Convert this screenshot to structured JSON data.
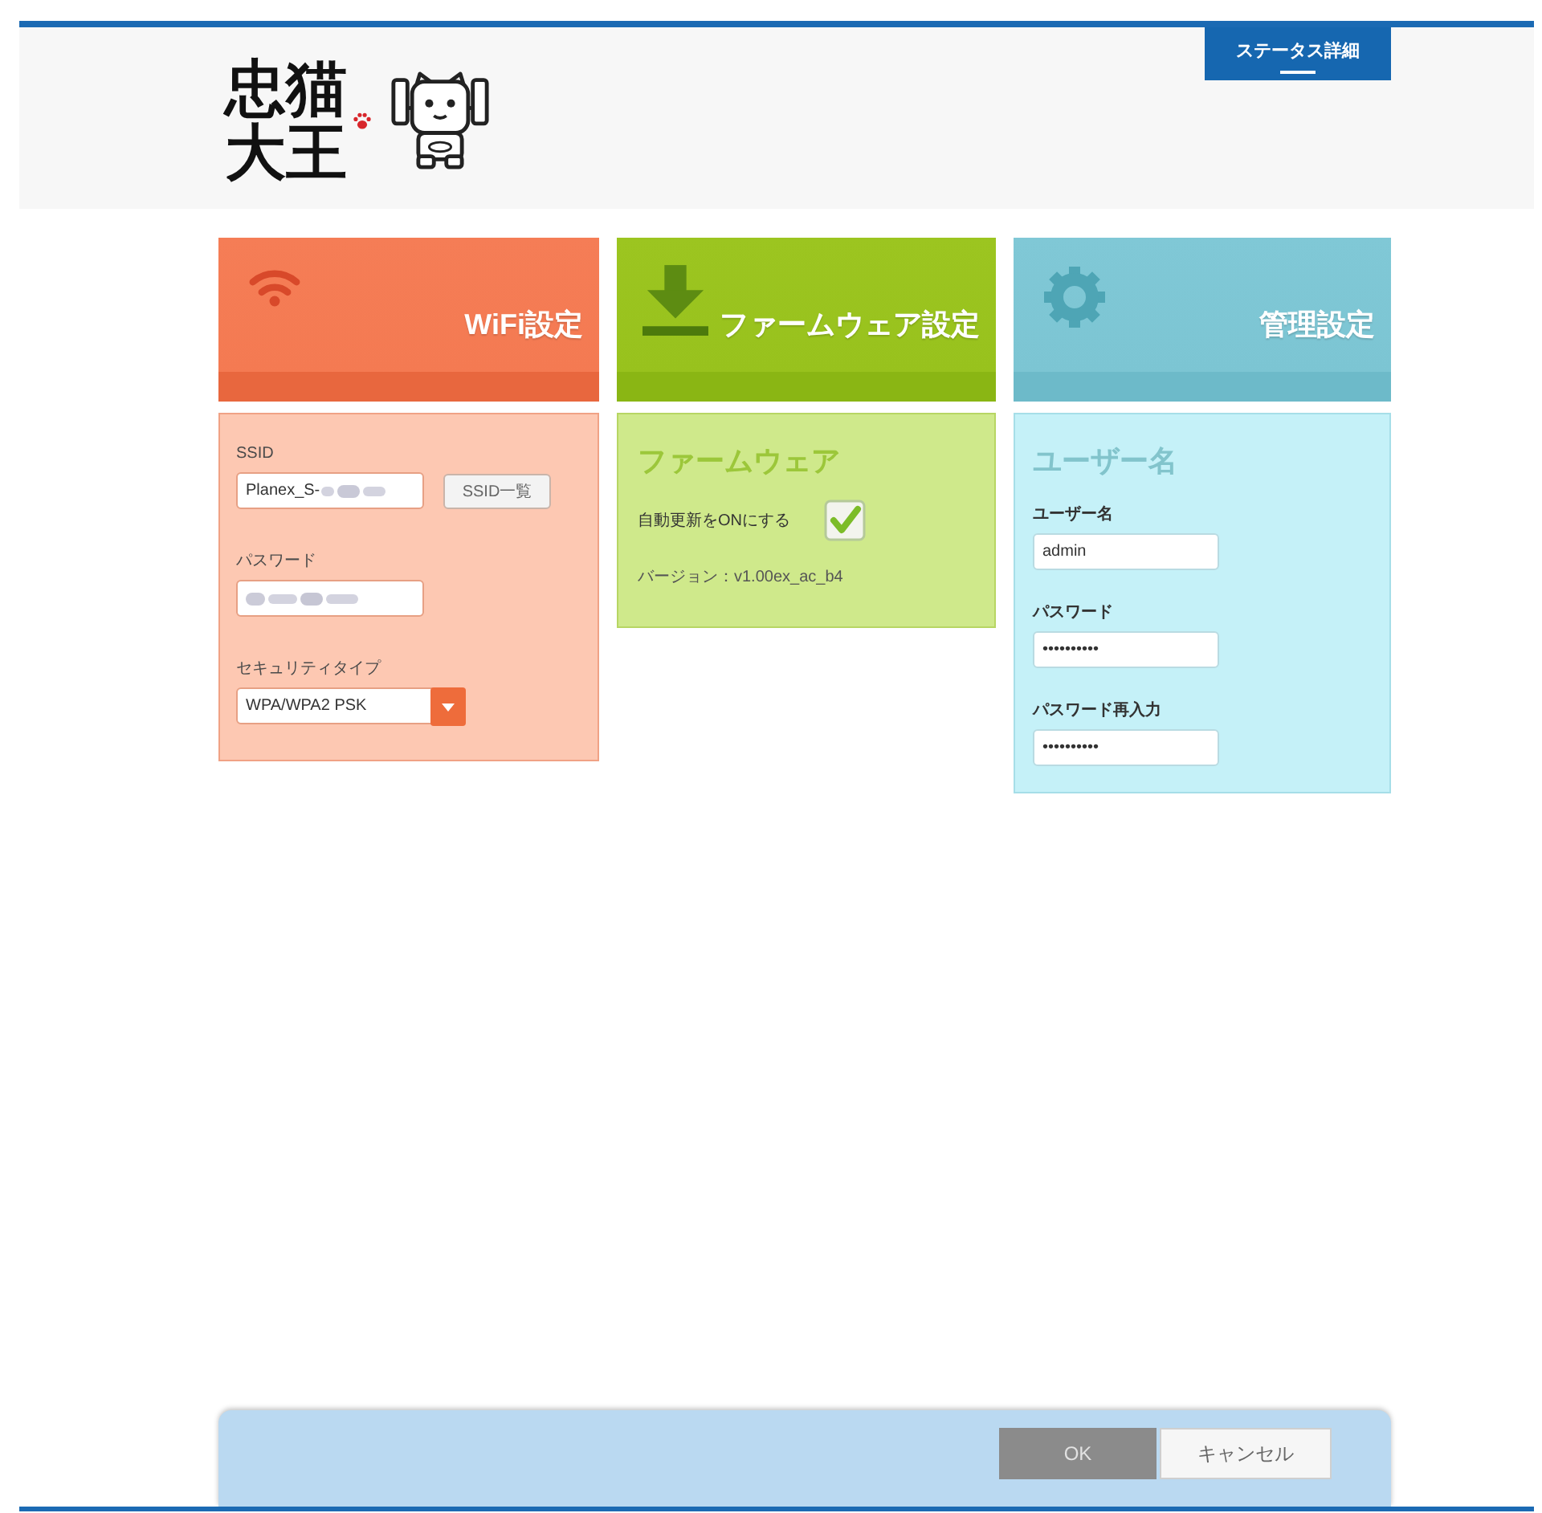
{
  "header": {
    "logo": "忠猫大王",
    "nav": [
      {
        "label": "ステータス詳細",
        "selected": true
      }
    ]
  },
  "sections": [
    {
      "kind": "wifi",
      "title": "WiFi設定",
      "fields": [
        {
          "kind": "text",
          "label": "SSID",
          "value": "Planex_S-",
          "blurred": true,
          "button": "SSID一覧"
        },
        {
          "kind": "password",
          "label": "パスワード",
          "blurred": true
        },
        {
          "kind": "select",
          "label": "セキュリティタイプ",
          "value": "WPA/WPA2 PSK"
        }
      ]
    },
    {
      "kind": "firmware",
      "title": "ファームウェア設定",
      "heading": "ファームウェア",
      "fields": [
        {
          "kind": "checkbox",
          "label": "自動更新をONにする",
          "checked": true
        },
        {
          "kind": "info",
          "text": "バージョン：v1.00ex_ac_b4"
        }
      ]
    },
    {
      "kind": "admin",
      "title": "管理設定",
      "heading": "ユーザー名",
      "fields": [
        {
          "kind": "text",
          "label": "ユーザー名",
          "value": "admin"
        },
        {
          "kind": "password",
          "label": "パスワード",
          "value": "••••••••••"
        },
        {
          "kind": "password",
          "label": "パスワード再入力",
          "value": "••••••••••"
        }
      ]
    }
  ],
  "footer": {
    "buttons": [
      {
        "kind": "primary",
        "label": "OK",
        "disabled": true
      },
      {
        "kind": "secondary",
        "label": "キャンセル",
        "disabled": false
      }
    ]
  }
}
